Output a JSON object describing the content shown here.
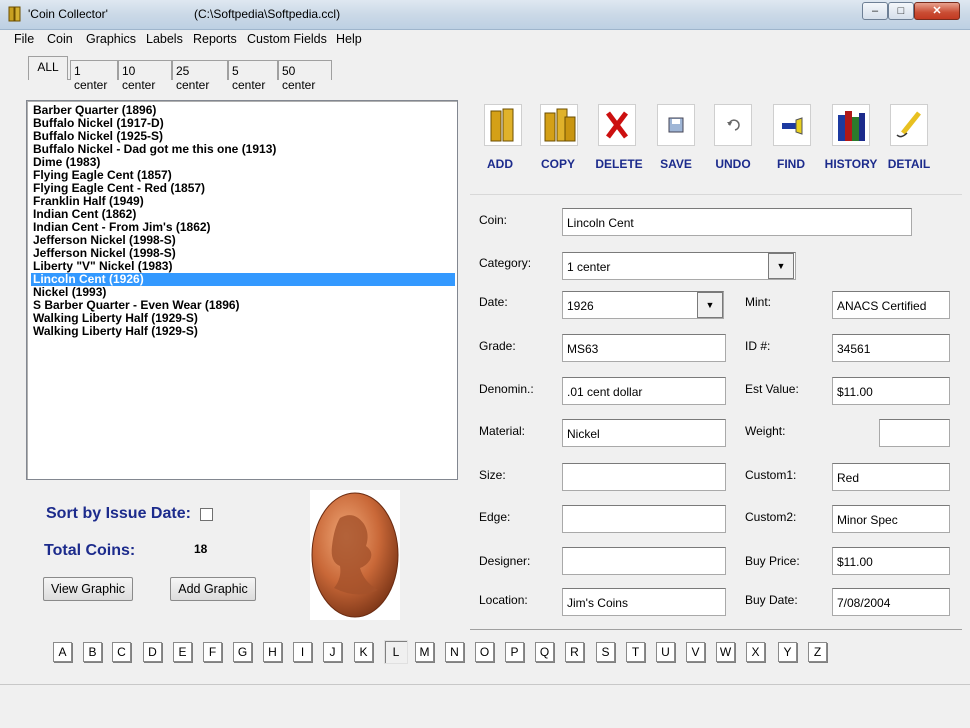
{
  "window": {
    "title": "'Coin Collector'",
    "path": "(C:\\Softpedia\\Softpedia.ccl)"
  },
  "menu": [
    "File",
    "Coin",
    "Graphics",
    "Labels",
    "Reports",
    "Custom Fields",
    "Help"
  ],
  "tabs": [
    "ALL",
    "1 center",
    "10 center",
    "25 center",
    "5 center",
    "50 center"
  ],
  "coins": [
    "Barber Quarter (1896)",
    "Buffalo Nickel (1917-D)",
    "Buffalo Nickel (1925-S)",
    "Buffalo Nickel - Dad got me this one (1913)",
    "Dime (1983)",
    "Flying Eagle Cent (1857)",
    "Flying Eagle Cent - Red (1857)",
    "Franklin Half (1949)",
    "Indian Cent (1862)",
    "Indian Cent - From Jim's (1862)",
    "Jefferson Nickel (1998-S)",
    "Jefferson Nickel (1998-S)",
    "Liberty \"V\" Nickel (1983)",
    "Lincoln Cent (1926)",
    "Nickel (1993)",
    "S Barber Quarter - Even Wear (1896)",
    "Walking Liberty Half (1929-S)",
    "Walking Liberty Half (1929-S)"
  ],
  "toolbar": [
    "ADD",
    "COPY",
    "DELETE",
    "SAVE",
    "UNDO",
    "FIND",
    "HISTORY",
    "DETAIL"
  ],
  "form": {
    "coin_label": "Coin:",
    "coin": "Lincoln Cent",
    "category_label": "Category:",
    "category": "1 center",
    "date_label": "Date:",
    "date": "1926",
    "mint_label": "Mint:",
    "mint": "ANACS Certified",
    "grade_label": "Grade:",
    "grade": "MS63",
    "id_label": "ID #:",
    "id": "34561",
    "denom_label": "Denomin.:",
    "denom": ".01 cent dollar",
    "estvalue_label": "Est Value:",
    "estvalue": "$11.00",
    "material_label": "Material:",
    "material": "Nickel",
    "weight_label": "Weight:",
    "weight": "",
    "size_label": "Size:",
    "size": "",
    "custom1_label": "Custom1:",
    "custom1": "Red",
    "edge_label": "Edge:",
    "edge": "",
    "custom2_label": "Custom2:",
    "custom2": "Minor Spec",
    "designer_label": "Designer:",
    "designer": "",
    "buyprice_label": "Buy Price:",
    "buyprice": "$11.00",
    "location_label": "Location:",
    "location": "Jim's Coins",
    "buydate_label": "Buy Date:",
    "buydate": "7/08/2004"
  },
  "sort_label": "Sort by Issue Date:",
  "total_label": "Total Coins:",
  "total_value": "18",
  "view_graphic": "View Graphic",
  "add_graphic": "Add Graphic",
  "letters": [
    "A",
    "B",
    "C",
    "D",
    "E",
    "F",
    "G",
    "H",
    "I",
    "J",
    "K",
    "L",
    "M",
    "N",
    "O",
    "P",
    "Q",
    "R",
    "S",
    "T",
    "U",
    "V",
    "W",
    "X",
    "Y",
    "Z"
  ],
  "colors": {
    "accent": "#1c2b8c",
    "selection": "#3399ff"
  }
}
